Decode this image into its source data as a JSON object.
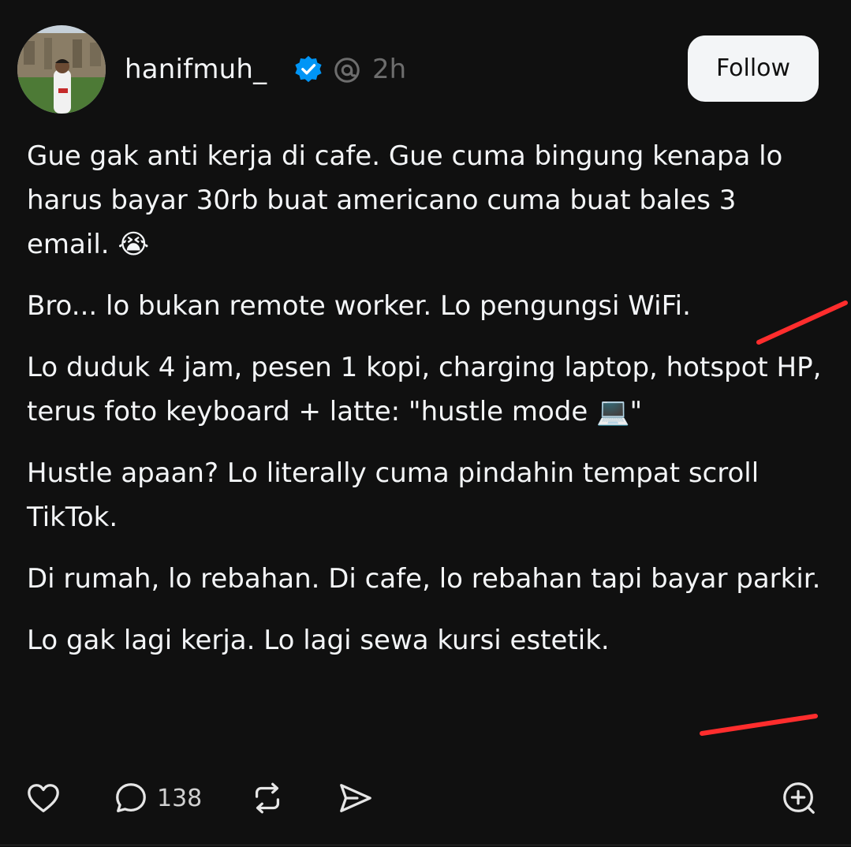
{
  "post": {
    "author": {
      "username": "hanifmuh_",
      "verified_icon": "verified-badge-icon",
      "avatar_icon": "profile-photo"
    },
    "timestamp": "2h",
    "follow_label": "Follow",
    "paragraphs": [
      "Gue gak anti kerja di cafe. Gue cuma bingung kenapa lo harus bayar 30rb buat americano cuma buat bales 3 email. 😭",
      "Bro... lo bukan remote worker. Lo pengungsi WiFi.",
      "Lo duduk 4 jam, pesen 1 kopi, charging laptop, hotspot HP, terus foto keyboard + latte: \"hustle mode 💻\"",
      "Hustle apaan? Lo literally cuma pindahin tempat scroll TikTok.",
      "Di rumah, lo rebahan. Di cafe, lo rebahan tapi bayar parkir.",
      "Lo gak lagi kerja. Lo lagi sewa kursi estetik."
    ],
    "actions": {
      "like_icon": "heart-icon",
      "reply_icon": "comment-icon",
      "reply_count": "138",
      "repost_icon": "repost-icon",
      "share_icon": "send-icon",
      "quote_icon": "add-circle-icon"
    }
  },
  "colors": {
    "background": "#101010",
    "text": "#f3f5f7",
    "muted": "#6d6d6d",
    "verified": "#0095f6",
    "annotation_mark": "#ff2d2d"
  }
}
